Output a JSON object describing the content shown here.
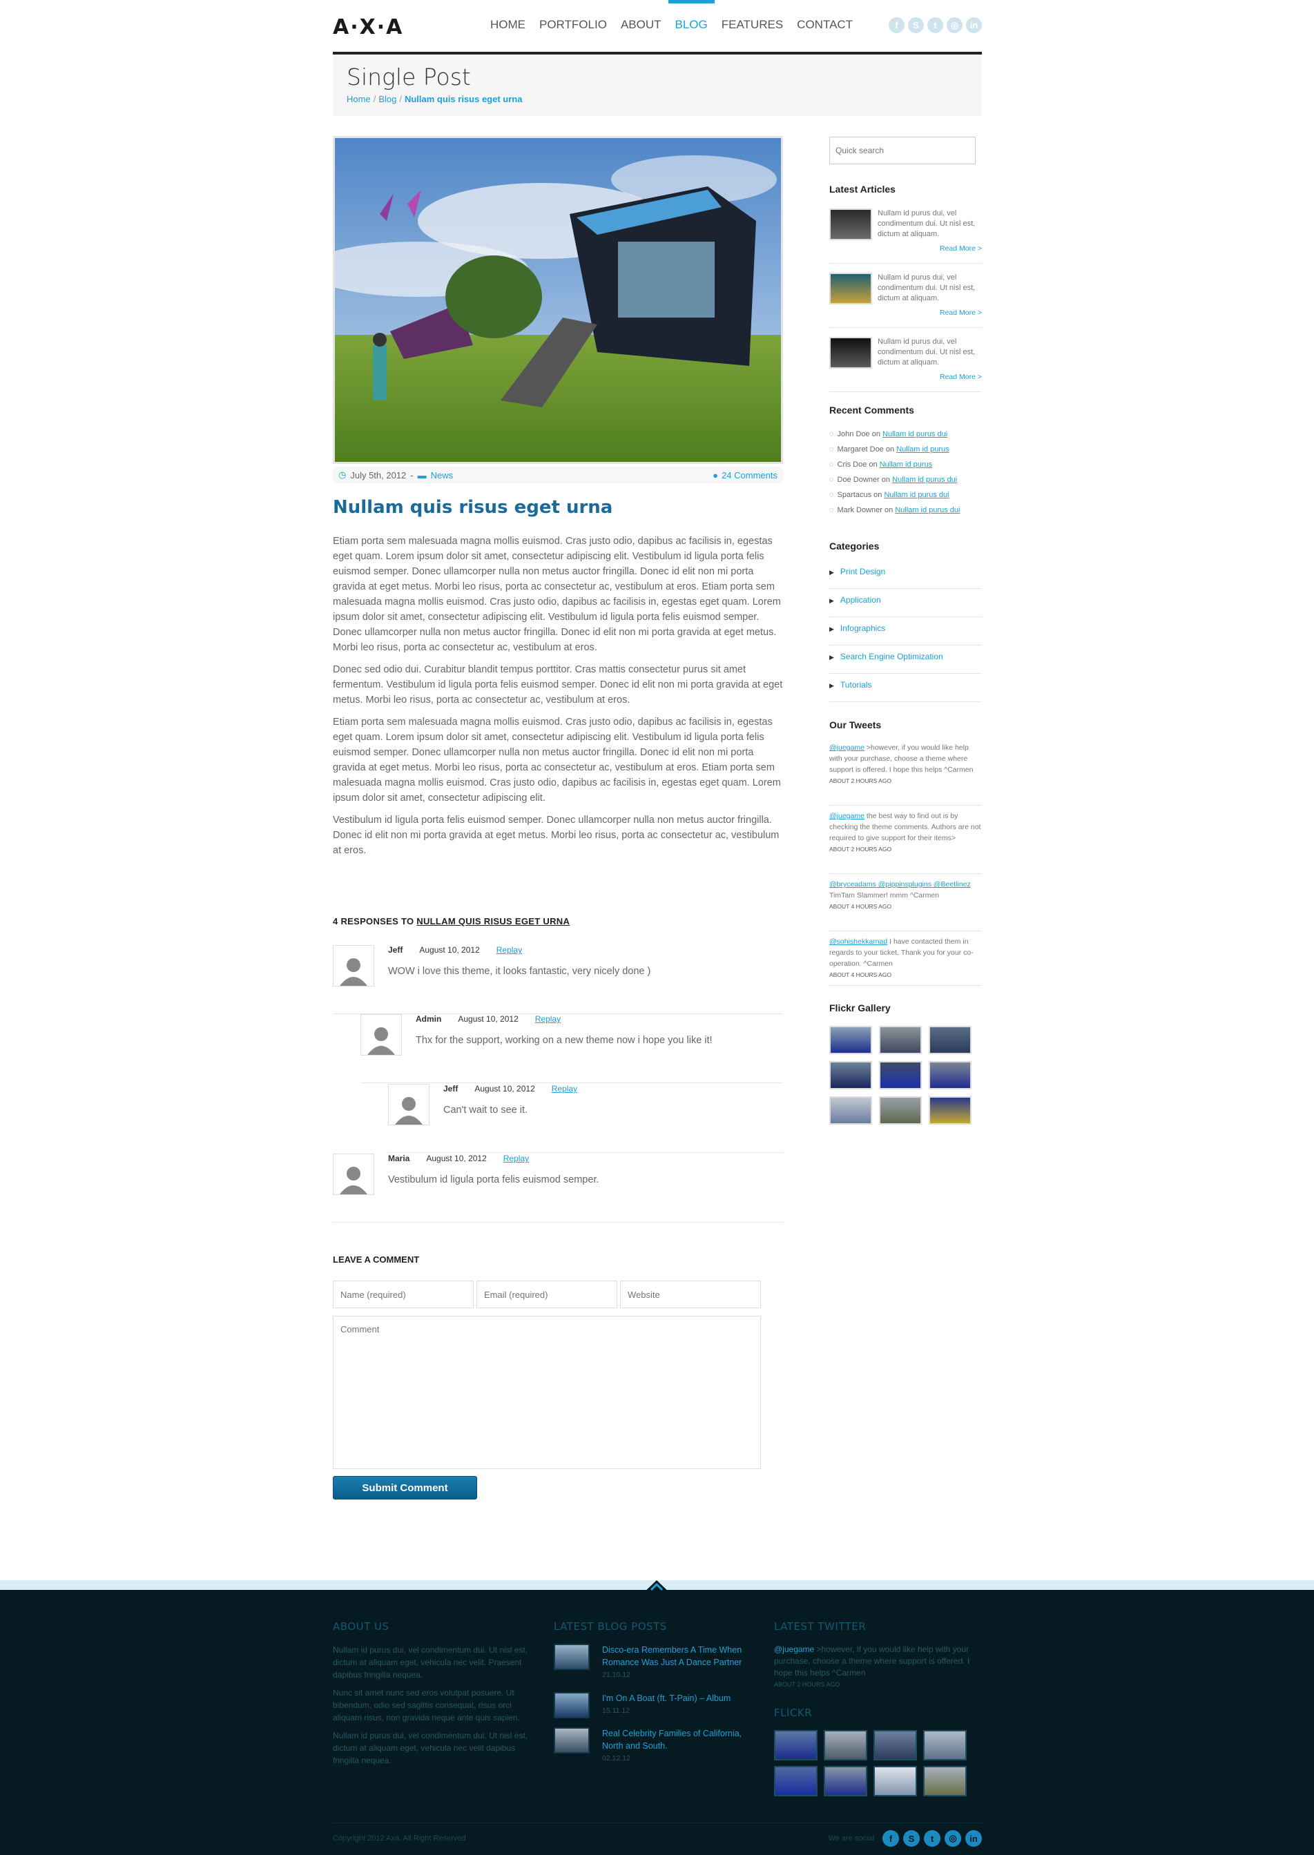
{
  "header": {
    "logo": "A·X·A",
    "nav": [
      "HOME",
      "PORTFOLIO",
      "ABOUT",
      "BLOG",
      "FEATURES",
      "CONTACT"
    ],
    "nav_active": "BLOG",
    "social_icons": [
      "facebook-icon",
      "skype-icon",
      "twitter-icon",
      "dribbble-icon",
      "linkedin-icon"
    ]
  },
  "titlebar": {
    "title": "Single Post",
    "crumb_home": "Home",
    "crumb_blog": "Blog",
    "crumb_current": "Nullam quis risus eget urna"
  },
  "post": {
    "date": "July 5th, 2012",
    "category": "News",
    "comments": "24 Comments",
    "title": "Nullam quis risus eget urna",
    "paragraphs": [
      "Etiam porta sem malesuada magna mollis euismod. Cras justo odio, dapibus ac facilisis in, egestas eget quam. Lorem ipsum dolor sit amet, consectetur adipiscing elit. Vestibulum id ligula porta felis euismod semper. Donec ullamcorper nulla non metus auctor fringilla. Donec id elit non mi porta gravida at eget metus. Morbi leo risus, porta ac consectetur ac, vestibulum at eros. Etiam porta sem malesuada magna mollis euismod. Cras justo odio, dapibus ac facilisis in, egestas eget quam. Lorem ipsum dolor sit amet, consectetur adipiscing elit. Vestibulum id ligula porta felis euismod semper. Donec ullamcorper nulla non metus auctor fringilla. Donec id elit non mi porta gravida at eget metus. Morbi leo risus, porta ac consectetur ac, vestibulum at eros.",
      "Donec sed odio dui. Curabitur blandit tempus porttitor. Cras mattis consectetur purus sit amet fermentum. Vestibulum id ligula porta felis euismod semper. Donec id elit non mi porta gravida at eget metus. Morbi leo risus, porta ac consectetur ac, vestibulum at eros.",
      "Etiam porta sem malesuada magna mollis euismod. Cras justo odio, dapibus ac facilisis in, egestas eget quam. Lorem ipsum dolor sit amet, consectetur adipiscing elit. Vestibulum id ligula porta felis euismod semper. Donec ullamcorper nulla non metus auctor fringilla. Donec id elit non mi porta gravida at eget metus. Morbi leo risus, porta ac consectetur ac, vestibulum at eros. Etiam porta sem malesuada magna mollis euismod. Cras justo odio, dapibus ac facilisis in, egestas eget quam. Lorem ipsum dolor sit amet, consectetur adipiscing elit.",
      "Vestibulum id ligula porta felis euismod semper. Donec ullamcorper nulla non metus auctor fringilla. Donec id elit non mi porta gravida at eget metus. Morbi leo risus, porta ac consectetur ac, vestibulum at eros."
    ]
  },
  "responses": {
    "prefix": "4 RESPONSES TO ",
    "link": "NULLAM QUIS RISUS EGET URNA",
    "items": [
      {
        "author": "Jeff",
        "date": "August 10, 2012",
        "reply": "Replay",
        "text": "WOW i love this theme, it looks fantastic, very nicely done )"
      },
      {
        "author": "Admin",
        "date": "August 10, 2012",
        "reply": "Replay",
        "text": "Thx for the support, working on a new theme now i hope you like it!"
      },
      {
        "author": "Jeff",
        "date": "August 10, 2012",
        "reply": "Replay",
        "text": "Can't wait to see it."
      },
      {
        "author": "Maria",
        "date": "August 10, 2012",
        "reply": "Replay",
        "text": "Vestibulum id ligula porta felis euismod semper."
      }
    ]
  },
  "form": {
    "heading": "LEAVE A COMMENT",
    "name_placeholder": "Name (required)",
    "email_placeholder": "Email (required)",
    "website_placeholder": "Website",
    "comment_placeholder": "Comment",
    "submit": "Submit Comment"
  },
  "sidebar": {
    "search_placeholder": "Quick search",
    "latest_title": "Latest Articles",
    "articles": [
      {
        "text": "Nullam id purus dui, vel condimentum dui. Ut nisl est, dictum at aliquam.",
        "more": "Read More >"
      },
      {
        "text": "Nullam id purus dui, vel condimentum dui. Ut nisl est, dictum at aliquam.",
        "more": "Read More >"
      },
      {
        "text": "Nullam id purus dui, vel condimentum dui. Ut nisl est, dictum at aliquam.",
        "more": "Read More >"
      }
    ],
    "recent_title": "Recent Comments",
    "recent": [
      {
        "who": "John Doe",
        "link": "Nullam id purus dui"
      },
      {
        "who": "Margaret Doe",
        "link": "Nullam id purus"
      },
      {
        "who": "Cris Doe",
        "link": "Nullam id purus"
      },
      {
        "who": "Doe Downer",
        "link": "Nullam id purus dui"
      },
      {
        "who": "Spartacus",
        "link": "Nullam id purus dui"
      },
      {
        "who": "Mark Downer",
        "link": "Nullam id purus dui"
      }
    ],
    "on_word": "on",
    "categories_title": "Categories",
    "categories": [
      "Print Design",
      "Application",
      "Infographics",
      "Search Engine Optimization",
      "Tutorials"
    ],
    "tweets_title": "Our Tweets",
    "tweets": [
      {
        "handle": "@juegame",
        "text": " >however, if you would like help with your purchase, choose a theme where support is offered. I hope this helps ^Carmen",
        "ago": "ABOUT 2 HOURS AGO"
      },
      {
        "handle": "@juegame",
        "text": " the best way to find out is by checking the theme comments. Authors are not required to give support for their items>",
        "ago": "ABOUT 2 HOURS AGO"
      },
      {
        "handle": "@bryceadams @pippinsplugins @Beetlinez",
        "text": " TimTam Slammer! mmm ^Carmen",
        "ago": "ABOUT 4 HOURS AGO"
      },
      {
        "handle": "@sohishekkarnad",
        "text": " I have contacted them in regards to your ticket. Thank you for your co-operation. ^Carmen",
        "ago": "ABOUT 4 HOURS AGO"
      }
    ],
    "flickr_title": "Flickr Gallery"
  },
  "footer": {
    "about_title": "ABOUT US",
    "about": [
      "Nullam id purus dui, vel condimentum dui. Ut nisl est, dictum at aliquam eget, vehicula nec velit. Praesent dapibus fringilla nequea.",
      "Nunc sit amet nunc sed eros volutpat posuere. Ut bibendum, odio sed sagittis consequat, risus orci aliquam risus, non gravida neque ante quis sapien.",
      "Nullam id purus dui, vel condimentum dui. Ut nisl est, dictum at aliquam eget, vehicula nec velit dapibus fringilla nequea."
    ],
    "blog_title": "LATEST BLOG POSTS",
    "posts": [
      {
        "title": "Disco-era Remembers A Time When Romance Was Just A Dance Partner",
        "date": "21.10.12"
      },
      {
        "title": "I'm On A Boat (ft. T-Pain) – Album",
        "date": "15.11.12"
      },
      {
        "title": "Real Celebrity Families of California, North and South.",
        "date": "02.12.12"
      }
    ],
    "twitter_title": "LATEST TWITTER",
    "tweet_handle": "@juegame",
    "tweet_text": " >however, if you would like help with your purchase, choose a theme where support is offered. I hope this helps ^Carmen",
    "tweet_ago": "ABOUT 2 HOURS AGO",
    "flickr_title": "FLICKR",
    "copyright": "Copyright 2012 Axa. All Right Reserved",
    "social_label": "We are social",
    "social_icons": [
      "facebook-icon",
      "skype-icon",
      "twitter-icon",
      "dribbble-icon",
      "linkedin-icon"
    ]
  },
  "colors": {
    "accent": "#1ba1d8",
    "footer_bg": "#061a22",
    "button": "#0a5d8a"
  }
}
